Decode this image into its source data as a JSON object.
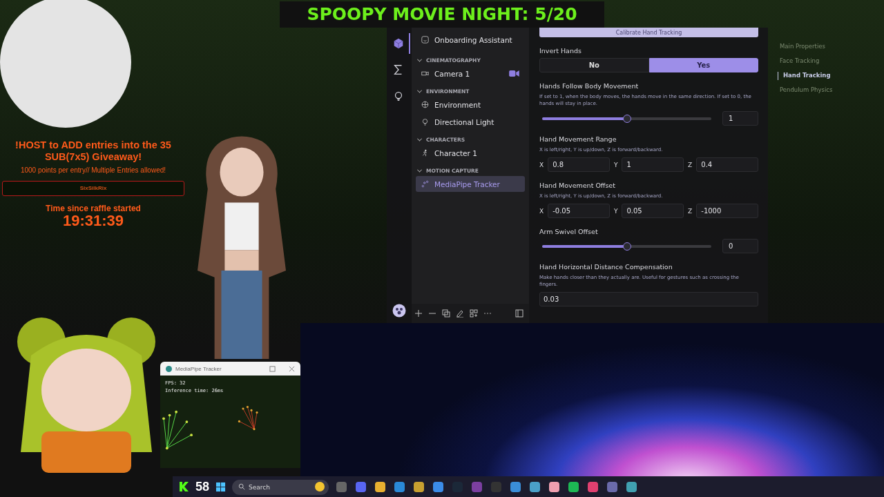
{
  "banner": {
    "title": "SPOOPY MOVIE NIGHT: 5/20"
  },
  "giveaway": {
    "headline": "!HOST to ADD entries into the 35 SUB(7x5) Giveaway!",
    "subtext": "1000 points per entry// Multiple Entries allowed!",
    "entrant": "SixSilkRix",
    "timer_label": "Time since raffle started",
    "timer": "19:31:39"
  },
  "app": {
    "rail": [
      {
        "kind": "cube",
        "selected": true
      },
      {
        "kind": "sigma",
        "selected": false
      },
      {
        "kind": "bulb",
        "selected": false
      }
    ],
    "tree": {
      "top_item": "Onboarding Assistant",
      "groups": [
        {
          "label": "CINEMATOGRAPHY",
          "expanded": true,
          "items": [
            {
              "label": "Camera 1",
              "kind": "camera",
              "selected": false
            }
          ]
        },
        {
          "label": "ENVIRONMENT",
          "expanded": true,
          "items": [
            {
              "label": "Environment",
              "kind": "environment",
              "selected": false
            },
            {
              "label": "Directional Light",
              "kind": "light",
              "selected": false
            }
          ]
        },
        {
          "label": "CHARACTERS",
          "expanded": true,
          "items": [
            {
              "label": "Character 1",
              "kind": "character",
              "selected": false
            }
          ]
        },
        {
          "label": "MOTION CAPTURE",
          "expanded": true,
          "items": [
            {
              "label": "MediaPipe Tracker",
              "kind": "tracker",
              "selected": true
            }
          ]
        }
      ]
    },
    "properties": {
      "top_button": "Calibrate Hand Tracking",
      "fields": [
        {
          "kind": "toggle",
          "label": "Invert Hands",
          "options": [
            {
              "label": "No",
              "selected": false
            },
            {
              "label": "Yes",
              "selected": true
            }
          ]
        },
        {
          "kind": "slider",
          "label": "Hands Follow Body Movement",
          "hint": "If set to 1, when the body moves, the hands move in the same direction. If set to 0, the hands will stay in place.",
          "level": 0.5,
          "value": "1"
        },
        {
          "kind": "vector",
          "label": "Hand Movement Range",
          "hint": "X is left/right, Y is up/down, Z is forward/backward.",
          "components": [
            {
              "axis": "X",
              "value": "0.8"
            },
            {
              "axis": "Y",
              "value": "1"
            },
            {
              "axis": "Z",
              "value": "0.4"
            }
          ]
        },
        {
          "kind": "vector",
          "label": "Hand Movement Offset",
          "hint": "X is left/right, Y is up/down, Z is forward/backward.",
          "components": [
            {
              "axis": "X",
              "value": "-0.05"
            },
            {
              "axis": "Y",
              "value": "0.05"
            },
            {
              "axis": "Z",
              "value": "-1000"
            }
          ]
        },
        {
          "kind": "slider",
          "label": "Arm Swivel Offset",
          "level": 0.5,
          "value": "0"
        },
        {
          "kind": "number",
          "label": "Hand Horizontal Distance Compensation",
          "hint": "Make hands closer than they actually are. Useful for gestures such as crossing the fingers.",
          "value": "0.03"
        }
      ]
    },
    "section_nav": [
      {
        "label": "Main Properties",
        "selected": false
      },
      {
        "label": "Face Tracking",
        "selected": false
      },
      {
        "label": "Hand Tracking",
        "selected": true
      },
      {
        "label": "Pendulum Physics",
        "selected": false
      }
    ]
  },
  "tracker_window": {
    "title": "MediaPipe Tracker",
    "fps": "FPS: 32",
    "inference": "Inference time: 26ms"
  },
  "taskbar": {
    "counter": "58",
    "search": {
      "placeholder": "Search"
    }
  }
}
